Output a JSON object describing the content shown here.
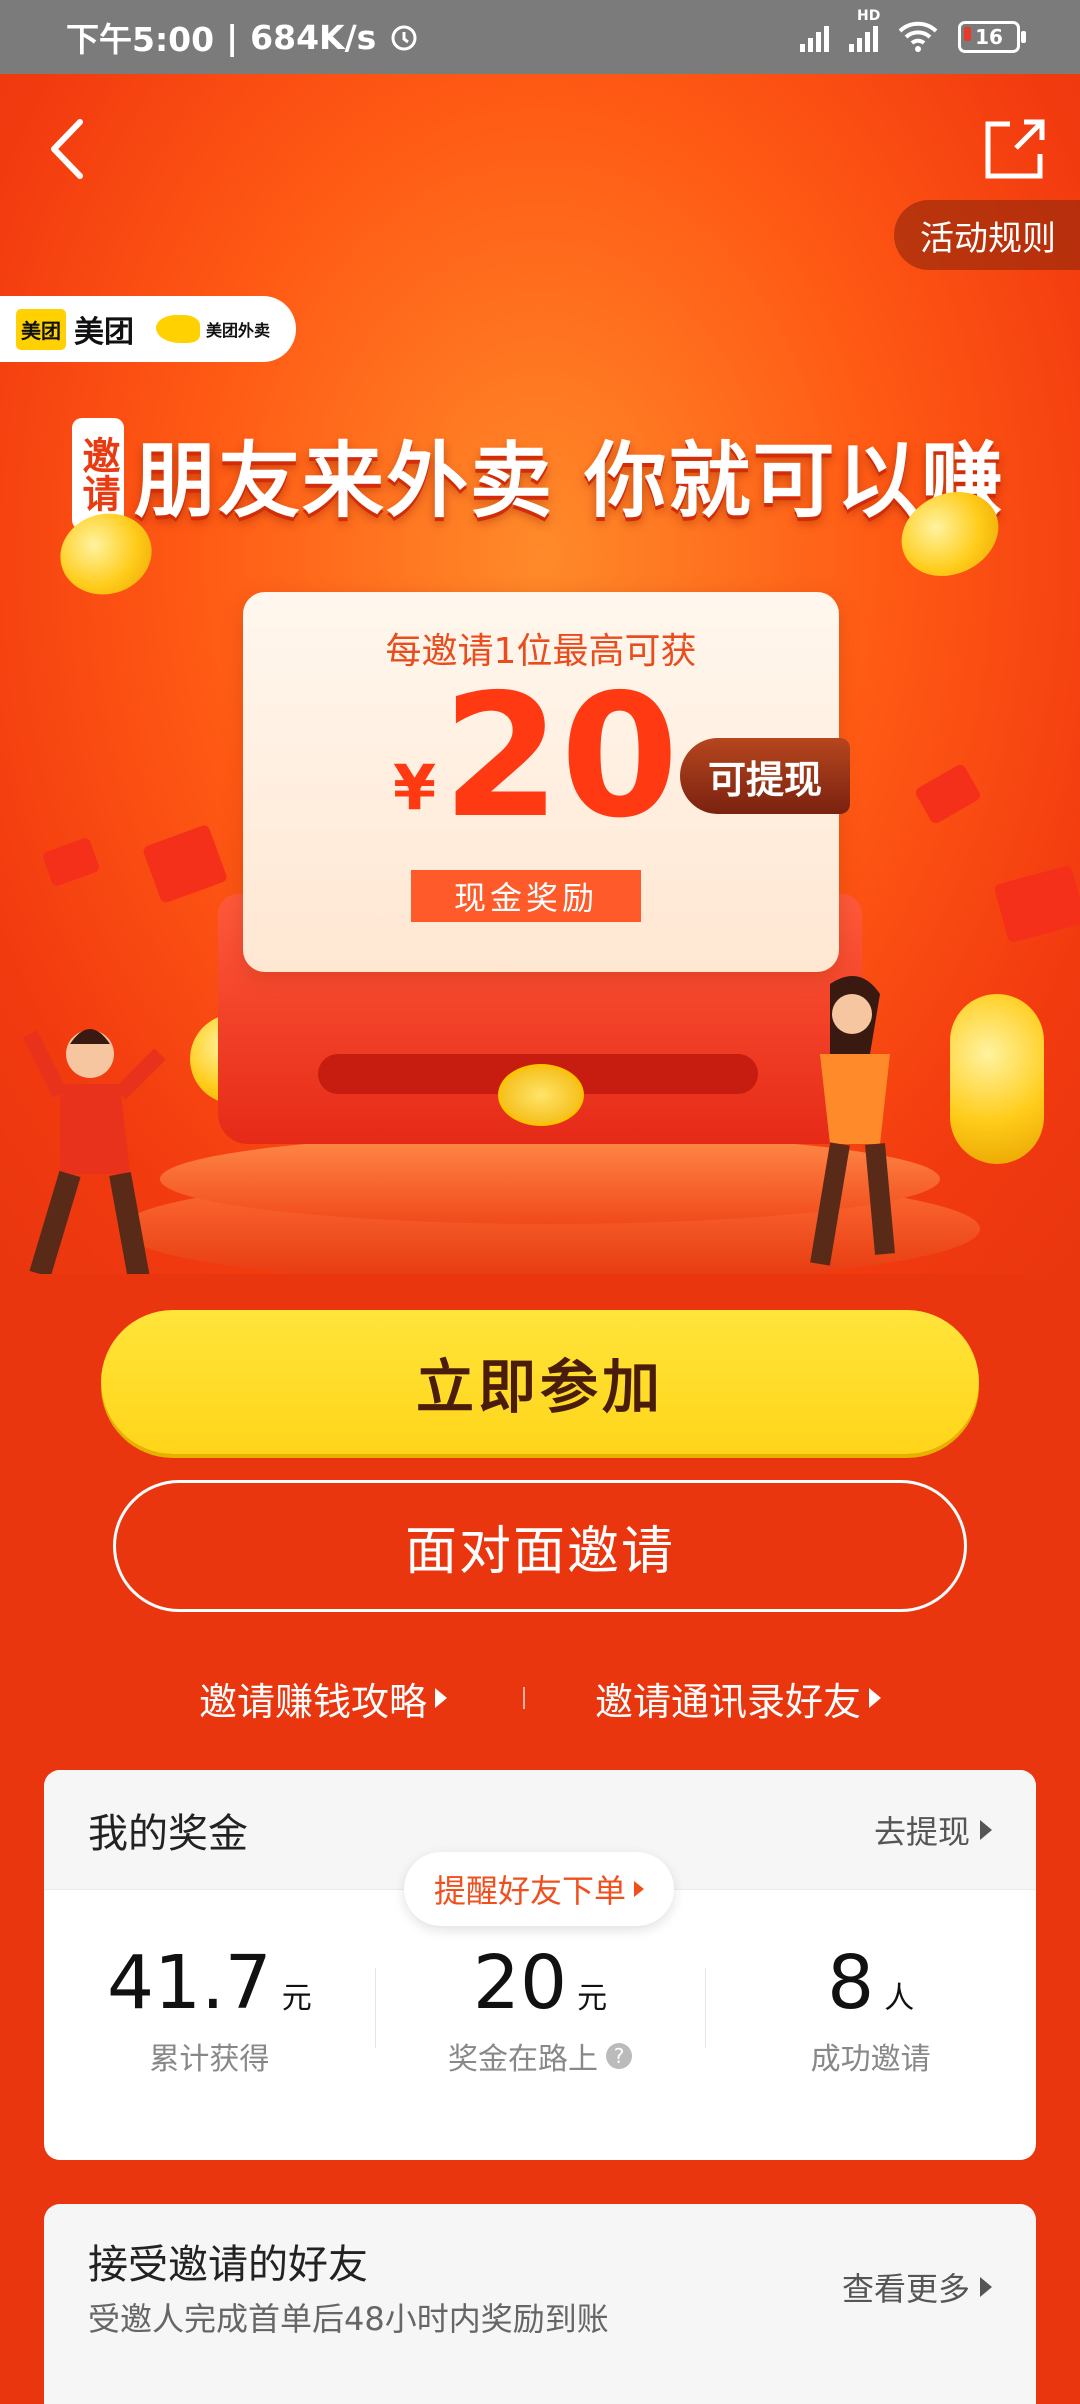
{
  "status_bar": {
    "time": "下午5:00",
    "speed": "684K/s",
    "network": "HD",
    "battery": "16"
  },
  "header": {
    "rules": "活动规则"
  },
  "brand": {
    "meituan": "美团",
    "logo_tag": "美团",
    "waimai": "美团外卖"
  },
  "hero": {
    "tag": "邀请",
    "headline": "朋友来外卖 你就可以赚",
    "card_sub": "每邀请1位最高可获",
    "currency": "¥",
    "amount": "20",
    "cash_label": "现金奖励",
    "withdraw_tag": "可提现"
  },
  "actions": {
    "join": "立即参加",
    "face_invite": "面对面邀请",
    "guide": "邀请赚钱攻略",
    "contacts": "邀请通讯录好友"
  },
  "bonus": {
    "title": "我的奖金",
    "withdraw": "去提现",
    "remind": "提醒好友下单",
    "stats": [
      {
        "value": "41.7",
        "unit": "元",
        "label": "累计获得"
      },
      {
        "value": "20",
        "unit": "元",
        "label": "奖金在路上"
      },
      {
        "value": "8",
        "unit": "人",
        "label": "成功邀请"
      }
    ]
  },
  "friends": {
    "title": "接受邀请的好友",
    "desc": "受邀人完成首单后48小时内奖励到账",
    "more": "查看更多"
  }
}
